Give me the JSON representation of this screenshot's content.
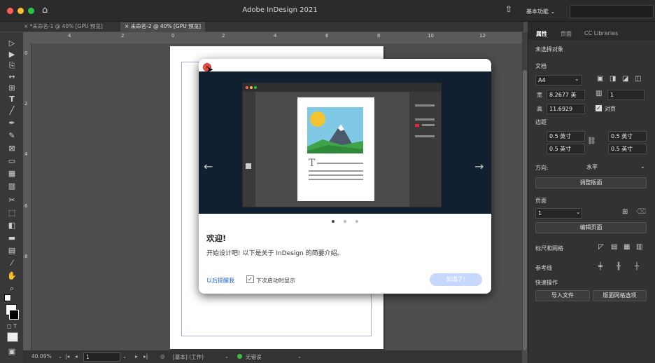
{
  "window": {
    "title": "Adobe InDesign 2021",
    "workspace": "基本功能 ⌄"
  },
  "tabs": [
    {
      "label": "× *未命名-1 @ 40% [GPU 预览]"
    },
    {
      "label": "× 未命名-2 @ 40% [GPU 预览]"
    }
  ],
  "ruler": {
    "top": [
      "4",
      "2",
      "0",
      "2",
      "4",
      "6",
      "8",
      "10",
      "12"
    ],
    "left": [
      "0",
      "2",
      "4",
      "6",
      "8"
    ]
  },
  "status": {
    "zoom": "40.09%",
    "page": "1",
    "layer": "[基本] (工作)",
    "preflight": "无错误"
  },
  "panel": {
    "tabs": [
      "属性",
      "页面",
      "CC Libraries"
    ],
    "selection": "未选择对象",
    "document_label": "文档",
    "page_size": "A4",
    "width_label": "宽",
    "width_value": "8.2677 英",
    "height_label": "高",
    "height_value": "11.6929",
    "pages_value": "1",
    "facing_label": "对页",
    "margins_label": "边距",
    "margin_top": "0.5 英寸",
    "margin_bottom": "0.5 英寸",
    "margin_left": "0.5 英寸",
    "margin_right": "0.5 英寸",
    "orientation_label": "方向:",
    "orientation_value": "水平",
    "adjust_layout": "调整版面",
    "pages_section": "页面",
    "page_number": "1",
    "edit_page": "编辑页面",
    "rulers_grids": "标尺和网格",
    "guides": "参考线",
    "quick_actions": "快速操作",
    "import_file": "导入文件",
    "layout_grid": "版面网格选项"
  },
  "dialog": {
    "heading": "欢迎!",
    "description": "开始设计吧! 以下是关于 InDesign 的简要介绍。",
    "remind_later": "以后提醒我",
    "show_next": "下次启动时显示",
    "ok_button": "知道了!",
    "hero_colors": {
      "background": "#112030",
      "accent": "#f4c430"
    }
  },
  "icons": {
    "home": "home-icon",
    "share": "share-icon",
    "close": "close-icon",
    "prev": "arrow-left-icon",
    "next": "arrow-right-icon"
  }
}
